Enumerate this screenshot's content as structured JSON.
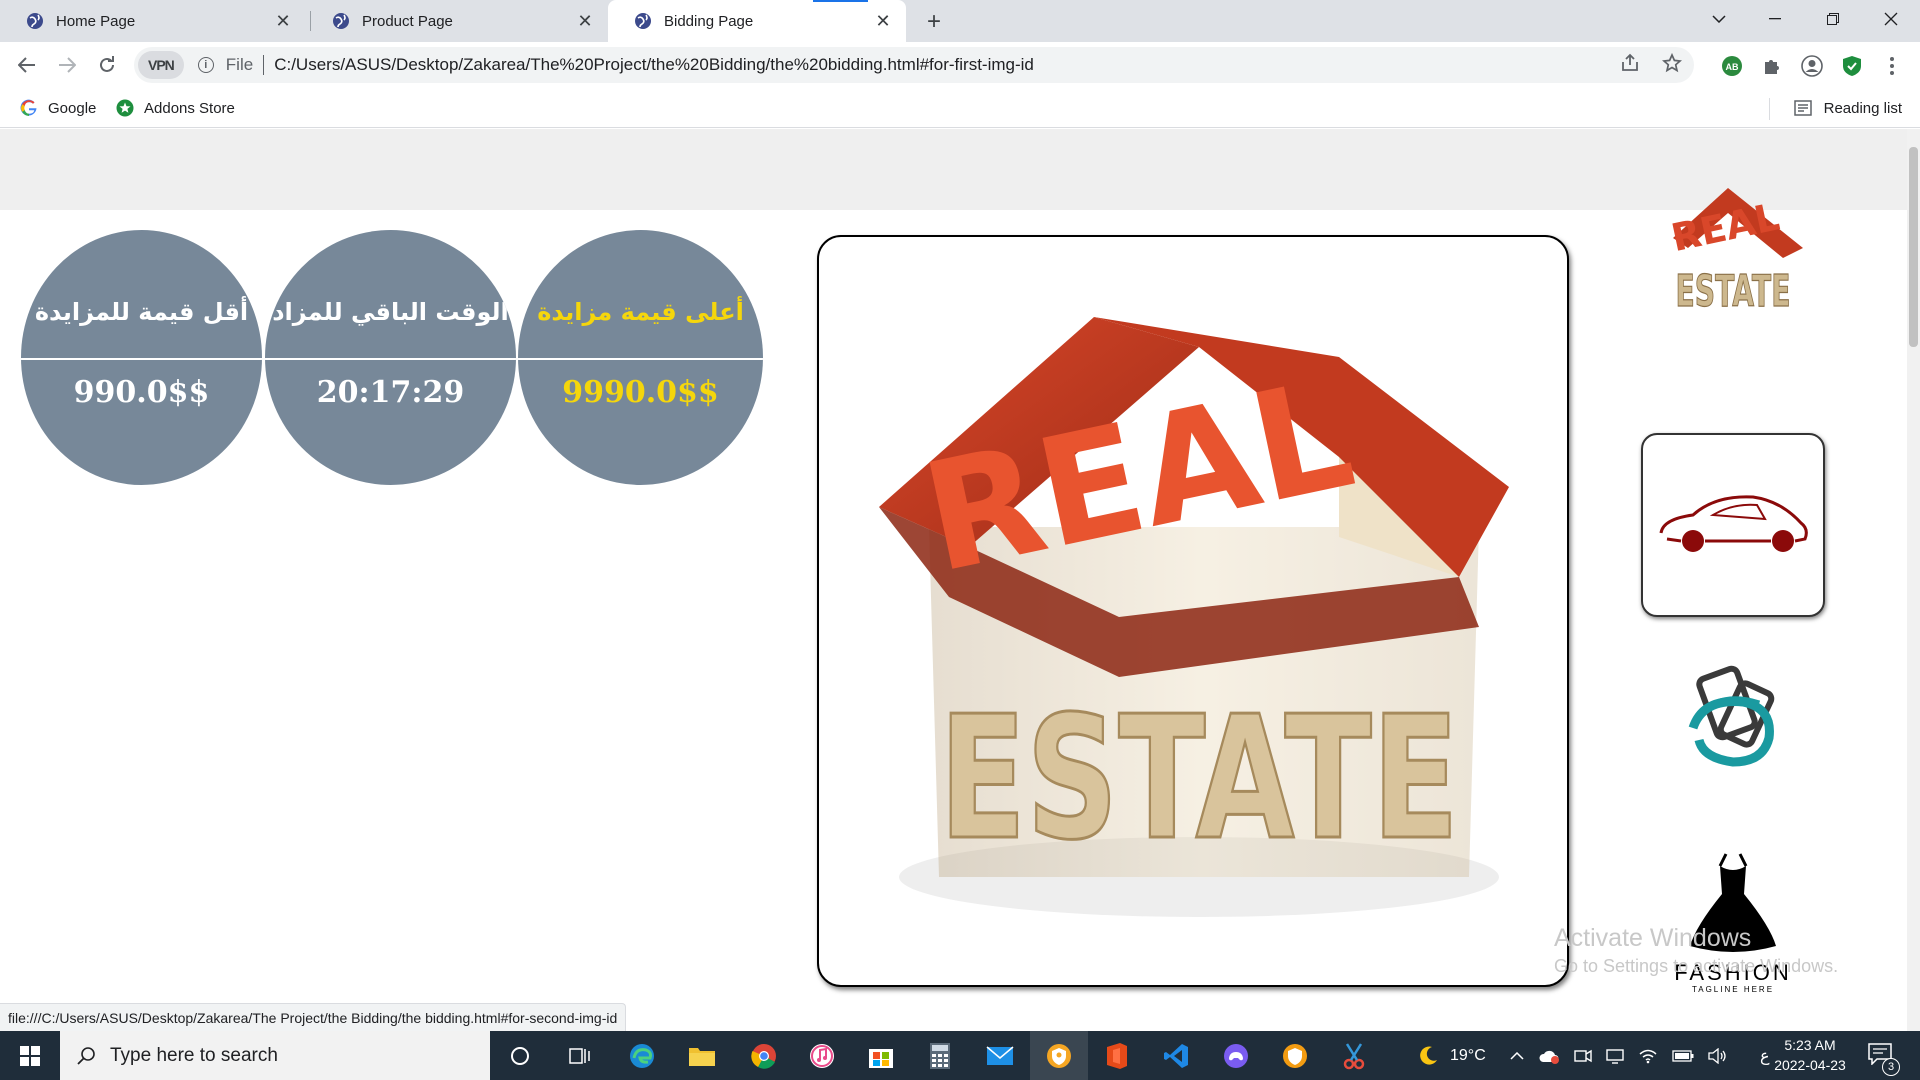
{
  "browser": {
    "tabs": [
      {
        "title": "Home Page",
        "active": false
      },
      {
        "title": "Product Page",
        "active": false
      },
      {
        "title": "Bidding Page",
        "active": true
      }
    ],
    "new_tab_symbol": "+",
    "address": {
      "vpn_label": "VPN",
      "scheme_label": "File",
      "url": "C:/Users/ASUS/Desktop/Zakarea/The%20Project/the%20Bidding/the%20bidding.html#for-first-img-id"
    },
    "bookmarks": [
      {
        "label": "Google",
        "icon": "google-icon"
      },
      {
        "label": "Addons Store",
        "icon": "addons-store-icon"
      }
    ],
    "reading_list_label": "Reading list",
    "status_bar_url": "file:///C:/Users/ASUS/Desktop/Zakarea/The Project/the Bidding/the bidding.html#for-second-img-id"
  },
  "auction": {
    "stats": [
      {
        "label": "أقل قيمة للمزايدة",
        "value": "990.0$$",
        "highlight": false
      },
      {
        "label": "الوقت الباقي للمزاد",
        "value": "20:17:29",
        "highlight": false
      },
      {
        "label": "أعلى قيمة مزايدة",
        "value": "9990.0$$",
        "highlight": true
      }
    ],
    "main_image": {
      "top_word": "REAL",
      "bottom_word": "ESTATE"
    },
    "thumbnails": [
      {
        "name": "real-estate-thumbnail",
        "top_word": "REAL",
        "bottom_word": "ESTATE"
      },
      {
        "name": "car-thumbnail"
      },
      {
        "name": "phones-thumbnail"
      },
      {
        "name": "fashion-thumbnail",
        "brand": "FASHION",
        "tagline": "TAGLINE HERE"
      }
    ],
    "colors": {
      "circle_bg": "#778899",
      "highlight_text": "#f5d60c",
      "roof": "#c0391f",
      "walls": "#d8c4a0",
      "car": "#8b0a0a",
      "phone_teal": "#1a9aa0"
    }
  },
  "watermark": {
    "line1": "Activate Windows",
    "line2": "Go to Settings to activate Windows."
  },
  "taskbar": {
    "search_placeholder": "Type here to search",
    "weather": "19°C",
    "language": "ع",
    "time": "5:23 AM",
    "date": "2022-04-23",
    "notification_count": "3"
  }
}
